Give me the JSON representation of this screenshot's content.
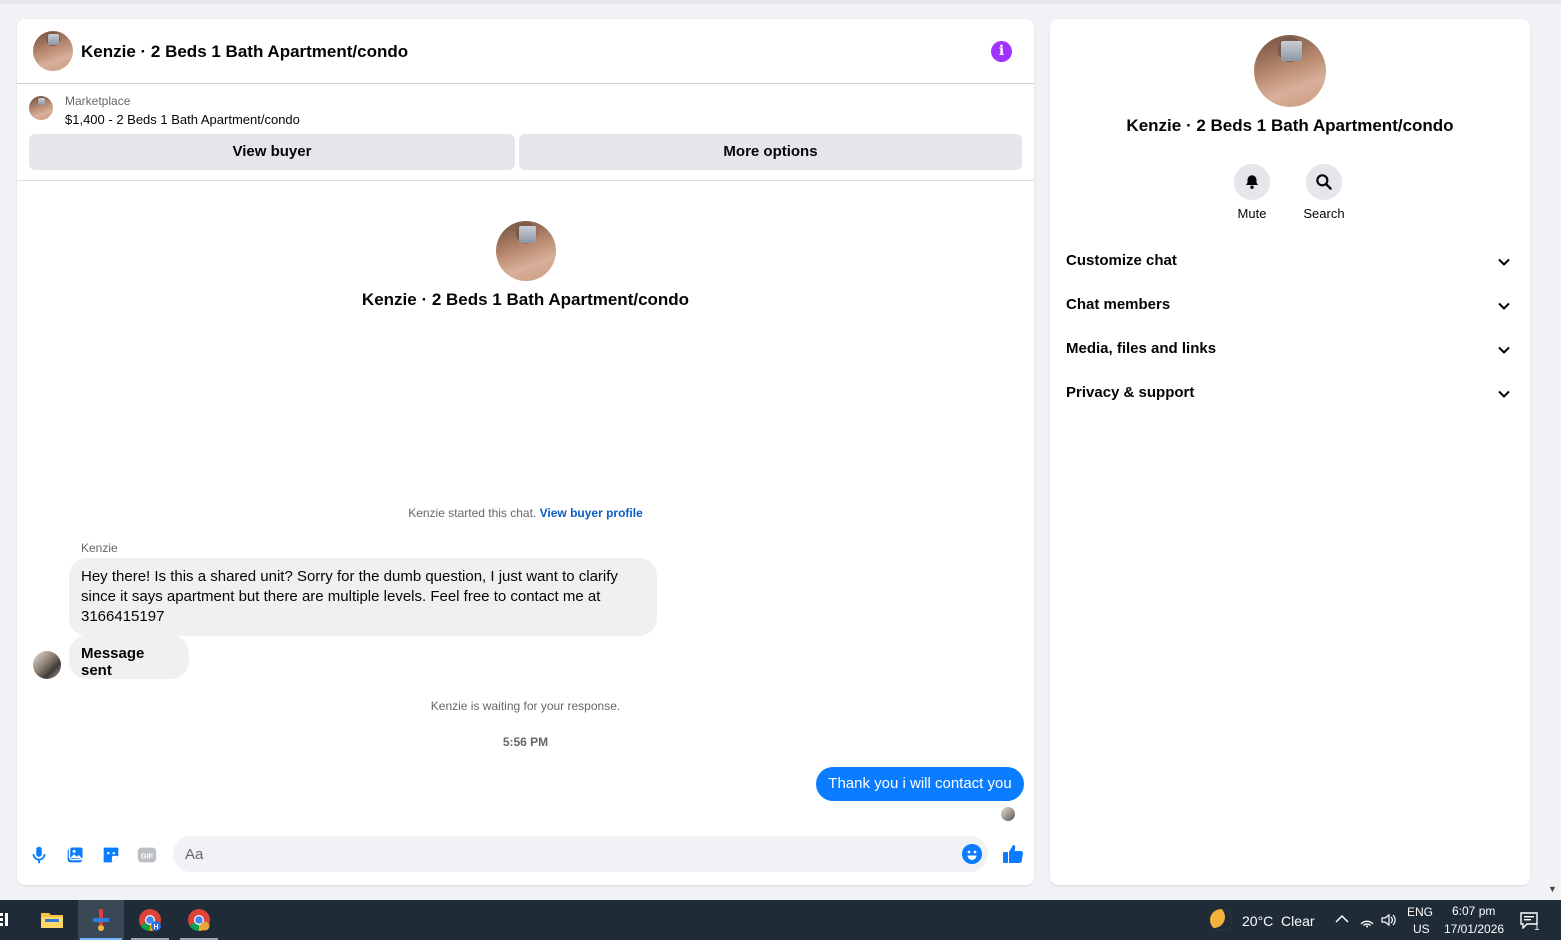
{
  "chat": {
    "header_title": "Kenzie · 2 Beds 1 Bath Apartment/condo",
    "marketplace_label": "Marketplace",
    "listing_text": "$1,400 - 2 Beds 1 Bath Apartment/condo",
    "view_buyer_label": "View buyer",
    "more_options_label": "More options",
    "intro_title": "Kenzie · 2 Beds 1 Bath Apartment/condo",
    "started_text": "Kenzie started this chat.",
    "view_buyer_profile_link": "View buyer profile",
    "sender_name": "Kenzie",
    "incoming_message": "Hey there! Is this a shared unit? Sorry for the dumb question, I just want to clarify since it says apartment but there are multiple levels. Feel free to contact me at 3166415197",
    "message_sent_label": "Message sent",
    "waiting_text": "Kenzie is waiting for your response.",
    "timestamp": "5:56 PM",
    "outgoing_message": "Thank you i will contact you",
    "composer_placeholder": "Aa"
  },
  "info_panel": {
    "title": "Kenzie · 2 Beds 1 Bath Apartment/condo",
    "mute_label": "Mute",
    "search_label": "Search",
    "sections": [
      {
        "label": "Customize chat"
      },
      {
        "label": "Chat members"
      },
      {
        "label": "Media, files and links"
      },
      {
        "label": "Privacy & support"
      }
    ]
  },
  "taskbar": {
    "weather": "20°C  Clear",
    "lang_line1": "ENG",
    "lang_line2": "US",
    "time": "6:07 pm",
    "date": "17/01/2026",
    "notification_count": "1"
  },
  "colors": {
    "accent_blue": "#0a7cff",
    "link_blue": "#0a5dc2",
    "info_purple": "#a033ff",
    "taskbar_bg": "#1f2b36"
  },
  "icons": [
    "info-icon",
    "microphone-icon",
    "photo-icon",
    "sticker-icon",
    "gif-icon",
    "emoji-icon",
    "thumbs-up-icon",
    "bell-icon",
    "search-icon",
    "chevron-down-icon",
    "folder-icon",
    "chrome-icon",
    "moon-icon",
    "wifi-icon",
    "volume-icon",
    "notification-icon"
  ]
}
